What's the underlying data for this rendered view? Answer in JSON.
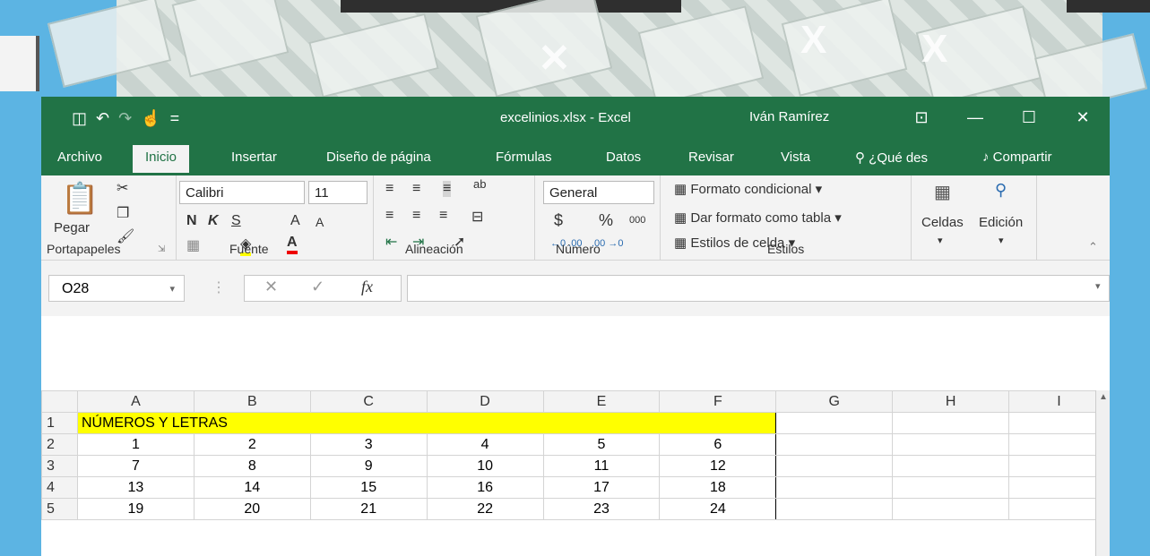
{
  "window": {
    "title": "excelinios.xlsx  -  Excel",
    "user": "Iván Ramírez",
    "qat": {
      "save_icon": "💾",
      "undo_icon": "↶",
      "redo_icon": "↷",
      "touch_icon": "☝",
      "more_icon": "="
    },
    "controls": {
      "ribbon_display": "⊡",
      "minimize": "—",
      "maximize": "☐",
      "close": "✕"
    }
  },
  "tabs": [
    {
      "label": "Archivo"
    },
    {
      "label": "Inicio"
    },
    {
      "label": "Insertar"
    },
    {
      "label": "Diseño de página"
    },
    {
      "label": "Fórmulas"
    },
    {
      "label": "Datos"
    },
    {
      "label": "Revisar"
    },
    {
      "label": "Vista"
    }
  ],
  "tell_me": "¿Qué des",
  "share": "Compartir",
  "ribbon": {
    "clipboard": {
      "label": "Portapapeles",
      "paste": "Pegar"
    },
    "font": {
      "label": "Fuente",
      "name": "Calibri",
      "size": "11",
      "bold": "N",
      "italic": "K",
      "underline": "S",
      "grow": "A",
      "shrink": "A"
    },
    "alignment": {
      "label": "Alineación",
      "wrap": "ab"
    },
    "number": {
      "label": "Número",
      "format": "General",
      "currency": "$",
      "percent": "%",
      "thousands": "000",
      "inc": "←0 .00",
      "dec": ".00 →0"
    },
    "styles": {
      "label": "Estilos",
      "conditional": "Formato condicional",
      "table": "Dar formato como tabla",
      "cell": "Estilos de celda"
    },
    "cells": {
      "label": "Celdas"
    },
    "editing": {
      "label": "Edición"
    }
  },
  "formula_bar": {
    "name_box": "O28",
    "cancel": "✕",
    "enter": "✓",
    "fx": "fx",
    "value": ""
  },
  "sheet": {
    "columns": [
      "A",
      "B",
      "C",
      "D",
      "E",
      "F",
      "G",
      "H",
      "I"
    ],
    "rows": [
      {
        "n": "1",
        "title": "NÚMEROS Y LETRAS"
      },
      {
        "n": "2",
        "cells": [
          "1",
          "2",
          "3",
          "4",
          "5",
          "6"
        ]
      },
      {
        "n": "3",
        "cells": [
          "7",
          "8",
          "9",
          "10",
          "11",
          "12"
        ]
      },
      {
        "n": "4",
        "cells": [
          "13",
          "14",
          "15",
          "16",
          "17",
          "18"
        ]
      },
      {
        "n": "5",
        "cells": [
          "19",
          "20",
          "21",
          "22",
          "23",
          "24"
        ]
      }
    ]
  },
  "colors": {
    "excel_green": "#217346",
    "highlight": "#ffff00",
    "ribbon_bg": "#f3f3f3"
  }
}
